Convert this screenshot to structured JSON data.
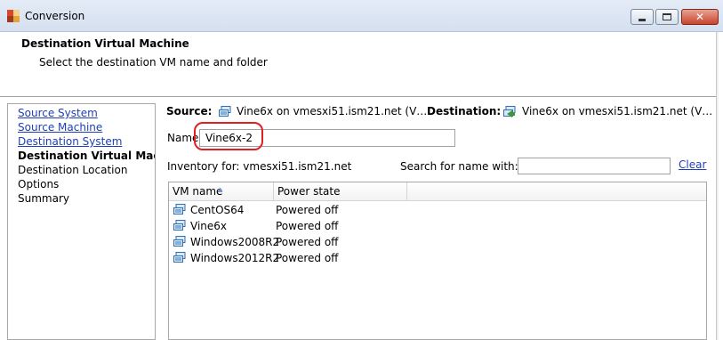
{
  "window": {
    "title": "Conversion"
  },
  "header": {
    "title": "Destination Virtual Machine",
    "subtitle": "Select the destination VM name and folder"
  },
  "sidebar": {
    "items": [
      {
        "label": "Source System",
        "state": "link"
      },
      {
        "label": "Source Machine",
        "state": "link"
      },
      {
        "label": "Destination System",
        "state": "link"
      },
      {
        "label": "Destination Virtual Mac",
        "state": "current"
      },
      {
        "label": "Destination Location",
        "state": "plain"
      },
      {
        "label": "Options",
        "state": "plain"
      },
      {
        "label": "Summary",
        "state": "plain"
      }
    ]
  },
  "summary": {
    "source_label": "Source:",
    "source_value": "Vine6x on vmesxi51.ism21.net (V…",
    "destination_label": "Destination:",
    "destination_value": "Vine6x on vmesxi51.ism21.net (V…"
  },
  "name_field": {
    "label": "Name:",
    "value": "Vine6x-2"
  },
  "inventory": {
    "label": "Inventory for: vmesxi51.ism21.net"
  },
  "search": {
    "label": "Search for name with:",
    "value": "",
    "clear_label": "Clear"
  },
  "table": {
    "columns": [
      "VM name",
      "Power state"
    ],
    "rows": [
      {
        "name": "CentOS64",
        "state": "Powered off"
      },
      {
        "name": "Vine6x",
        "state": "Powered off"
      },
      {
        "name": "Windows2008R2",
        "state": "Powered off"
      },
      {
        "name": "Windows2012R2",
        "state": "Powered off"
      }
    ]
  },
  "colors": {
    "link": "#1e3fb5",
    "highlight": "#e02020",
    "vm_icon": "#2f6fb3"
  },
  "icons": {
    "app": "conversion-app-icon",
    "vm": "vm-icon",
    "destination": "vm-convert-icon"
  }
}
